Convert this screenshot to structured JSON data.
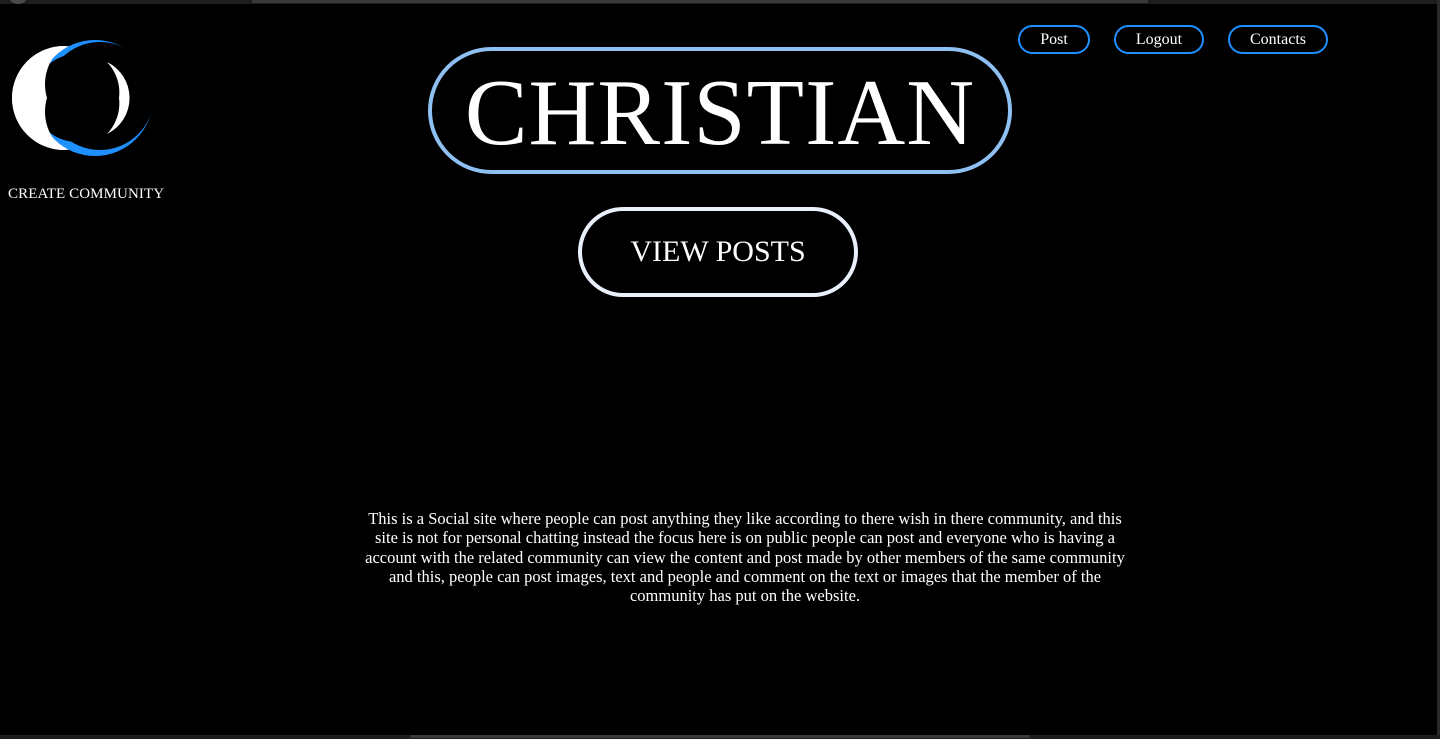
{
  "brand": {
    "logo_icon": "double-c-logo-icon",
    "community_link": "CREATE COMMUNITY"
  },
  "nav": {
    "post": "Post",
    "logout": "Logout",
    "contacts": "Contacts"
  },
  "hero": {
    "title": "CHRISTIAN",
    "view_posts": "VIEW POSTS"
  },
  "about": {
    "text": "This is a Social site where people can post anything they like according to there wish in there community, and this site is not for personal chatting instead the focus here is on public people can post and everyone who is having a account with the related community can view the content and post made by other members of the same community and this, people can post images, text and people and comment on the text or images that the member of the community has put on the website."
  },
  "colors": {
    "background": "#000000",
    "accent_blue": "#1e90ff",
    "title_border": "#8fc0f2",
    "button_border": "#e8f1fb",
    "text": "#ffffff"
  }
}
